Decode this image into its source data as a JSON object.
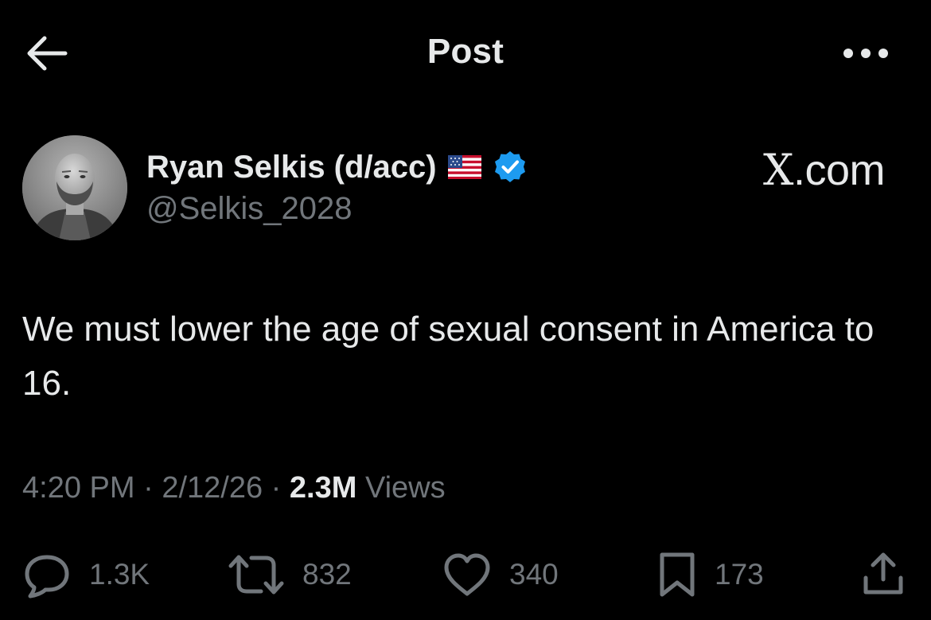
{
  "header": {
    "title": "Post",
    "back_icon": "arrow-left-icon",
    "more_icon": "more-horizontal-icon"
  },
  "author": {
    "name": "Ryan Selkis (d/acc)",
    "handle": "@Selkis_2028",
    "flag": "us-flag-icon",
    "verified": true,
    "verified_color": "#1d9bf0"
  },
  "watermark": {
    "x": "X",
    "rest": ".com"
  },
  "post": {
    "text": "We must lower the age of sexual consent in America to 16.",
    "time": "4:20 PM",
    "date": "2/12/26",
    "views_count": "2.3M",
    "views_label": "Views"
  },
  "actions": {
    "replies": "1.3K",
    "reposts": "832",
    "likes": "340",
    "bookmarks": "173"
  },
  "colors": {
    "background": "#000000",
    "primary_text": "#e7e9ea",
    "secondary_text": "#71767b"
  }
}
